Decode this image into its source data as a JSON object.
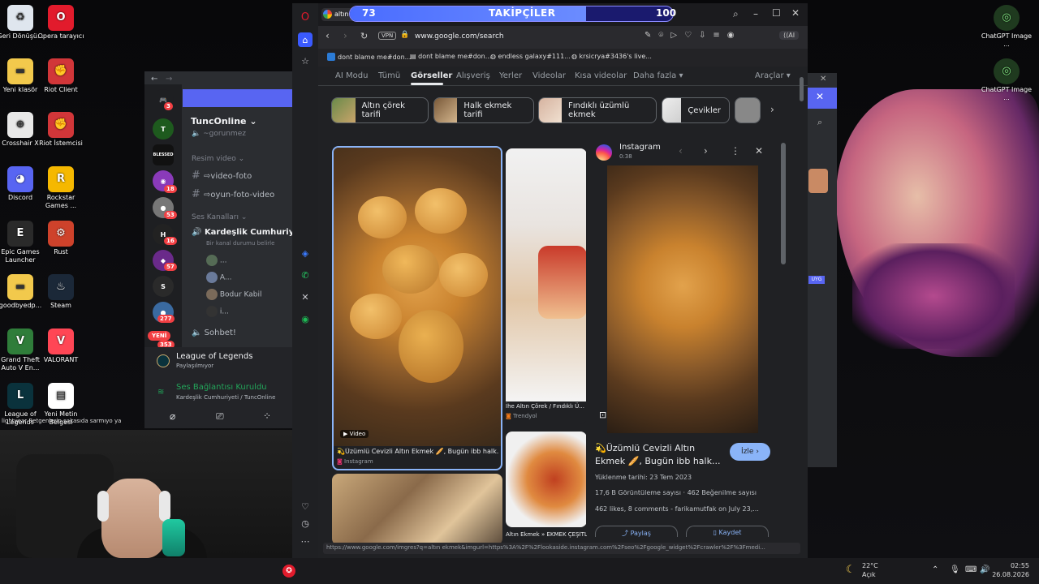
{
  "desktop": {
    "left_icons": [
      {
        "label": "Geri Dönüşü...",
        "icon": "recycle-bin-icon",
        "color": "#dfe6ee"
      },
      {
        "label": "Opera tarayıcı",
        "icon": "opera-icon",
        "color": "#e21b2c"
      },
      {
        "label": "Yeni klasör",
        "icon": "folder-icon",
        "color": "#f2c94c"
      },
      {
        "label": "Riot Client",
        "icon": "riot-icon",
        "color": "#d13639"
      },
      {
        "label": "Crosshair X",
        "icon": "crosshair-icon",
        "color": "#e8e8e8"
      },
      {
        "label": "Riot İstemcisi",
        "icon": "riot-icon",
        "color": "#d13639"
      },
      {
        "label": "Discord",
        "icon": "discord-icon",
        "color": "#5865f2"
      },
      {
        "label": "Rockstar Games ...",
        "icon": "rockstar-icon",
        "color": "#f5b800"
      },
      {
        "label": "Epic Games Launcher",
        "icon": "epic-icon",
        "color": "#2a2a2a"
      },
      {
        "label": "Rust",
        "icon": "rust-icon",
        "color": "#ce422b"
      },
      {
        "label": "goodbyedp...",
        "icon": "folder-icon",
        "color": "#f2c94c"
      },
      {
        "label": "Steam",
        "icon": "steam-icon",
        "color": "#1b2838"
      },
      {
        "label": "Grand Theft Auto V En...",
        "icon": "gta-icon",
        "color": "#2f7d3a"
      },
      {
        "label": "VALORANT",
        "icon": "valorant-icon",
        "color": "#ff4655"
      },
      {
        "label": "League of Legends",
        "icon": "lol-icon",
        "color": "#0a323c"
      },
      {
        "label": "Yeni Metin Belgesi",
        "icon": "text-file-icon",
        "color": "#ffffff"
      }
    ],
    "right_icons": [
      {
        "label": "ChatGPT Image ...",
        "icon": "image-icon"
      },
      {
        "label": "ChatGPT Image ...",
        "icon": "image-icon"
      }
    ],
    "overlay_text": "lightyear Betgenlerin şakasıda sarmıyo ya"
  },
  "discord": {
    "server_name": "TuncOnline",
    "top_channel": "gorunmez",
    "category_video": "Resim video",
    "channels": [
      "video-foto",
      "oyun-foto-video"
    ],
    "category_voice": "Ses Kanalları",
    "voice_channel": "Kardeşlik Cumhuriy...",
    "voice_status": "Bir kanal durumu belirle",
    "voice_users": [
      "...",
      "A...",
      "Bodur Kabil",
      "i..."
    ],
    "sohbet": "Sohbet!",
    "activity_title": "League of Legends",
    "activity_sub": "Paylaşılmıyor",
    "connection_title": "Ses Bağlantısı Kuruldu",
    "connection_sub": "Kardeşlik Cumhuriyeti / TuncOnline",
    "badges": [
      "3",
      "18",
      "53",
      "16",
      "57",
      "277",
      "353"
    ],
    "new_label": "YENİ"
  },
  "browser": {
    "tab_title": "altın ekm...",
    "follower_label": "TAKİPÇİLER",
    "follower_current": "73",
    "follower_goal": "100",
    "follower_progress": 0.73,
    "vpn": "VPN",
    "url": "www.google.com/search",
    "ai_label": "AI",
    "bookmarks": [
      "dont blame me#don...",
      "dont blame me#don...",
      "endless galaxy#111...",
      "krsicrya#3436's live..."
    ],
    "google_tabs": [
      "AI Modu",
      "Tümü",
      "Görseller",
      "Alışveriş",
      "Yerler",
      "Videolar",
      "Kısa videolar",
      "Daha fazla"
    ],
    "tools": "Araçlar",
    "chips": [
      "Altın çörek tarifi",
      "Halk ekmek tarifi",
      "Fındıklı üzümlü ekmek",
      "Çevikler"
    ],
    "results": [
      {
        "caption": "Üzümlü Cevizli Altın Ekmek 🥖, Bugün ibb halk...",
        "source": "Instagram",
        "badge": "Video"
      },
      {
        "caption": "İhe Altın Çörek / Fındıklı Ü...",
        "source": "Trendyol"
      },
      {
        "caption": "Altın Ekmek » EKMEK ÇEŞİTLERİ » UNLU MAMULLER »...",
        "source": ""
      }
    ],
    "panel": {
      "source": "Instagram",
      "time": "0:38",
      "title": "Üzümlü Cevizli Altın Ekmek 🥖, Bugün ibb halk...",
      "watch": "İzle",
      "upload": "Yüklenme tarihi: 23 Tem 2023",
      "stats": "17,6 B Görüntüleme sayısı · 462 Beğenilme sayısı",
      "desc": "462 likes, 8 comments - farikamutfak on July 23,...",
      "share": "Paylaş",
      "save": "Kaydet"
    },
    "status_url": "https://www.google.com/imgres?q=altın ekmek&imgurl=https%3A%2F%2Flookaside.instagram.com%2Fseo%2Fgoogle_widget%2Fcrawler%2F%3Fmedi..."
  },
  "taskbar": {
    "weather_temp": "22°C",
    "weather_desc": "Açık",
    "time": "02:55",
    "date": "26.08.2026"
  },
  "colors": {
    "discord_bg": "#2b2d31",
    "google_blue": "#8ab4f8",
    "follower_bar": "#4a6cff"
  }
}
